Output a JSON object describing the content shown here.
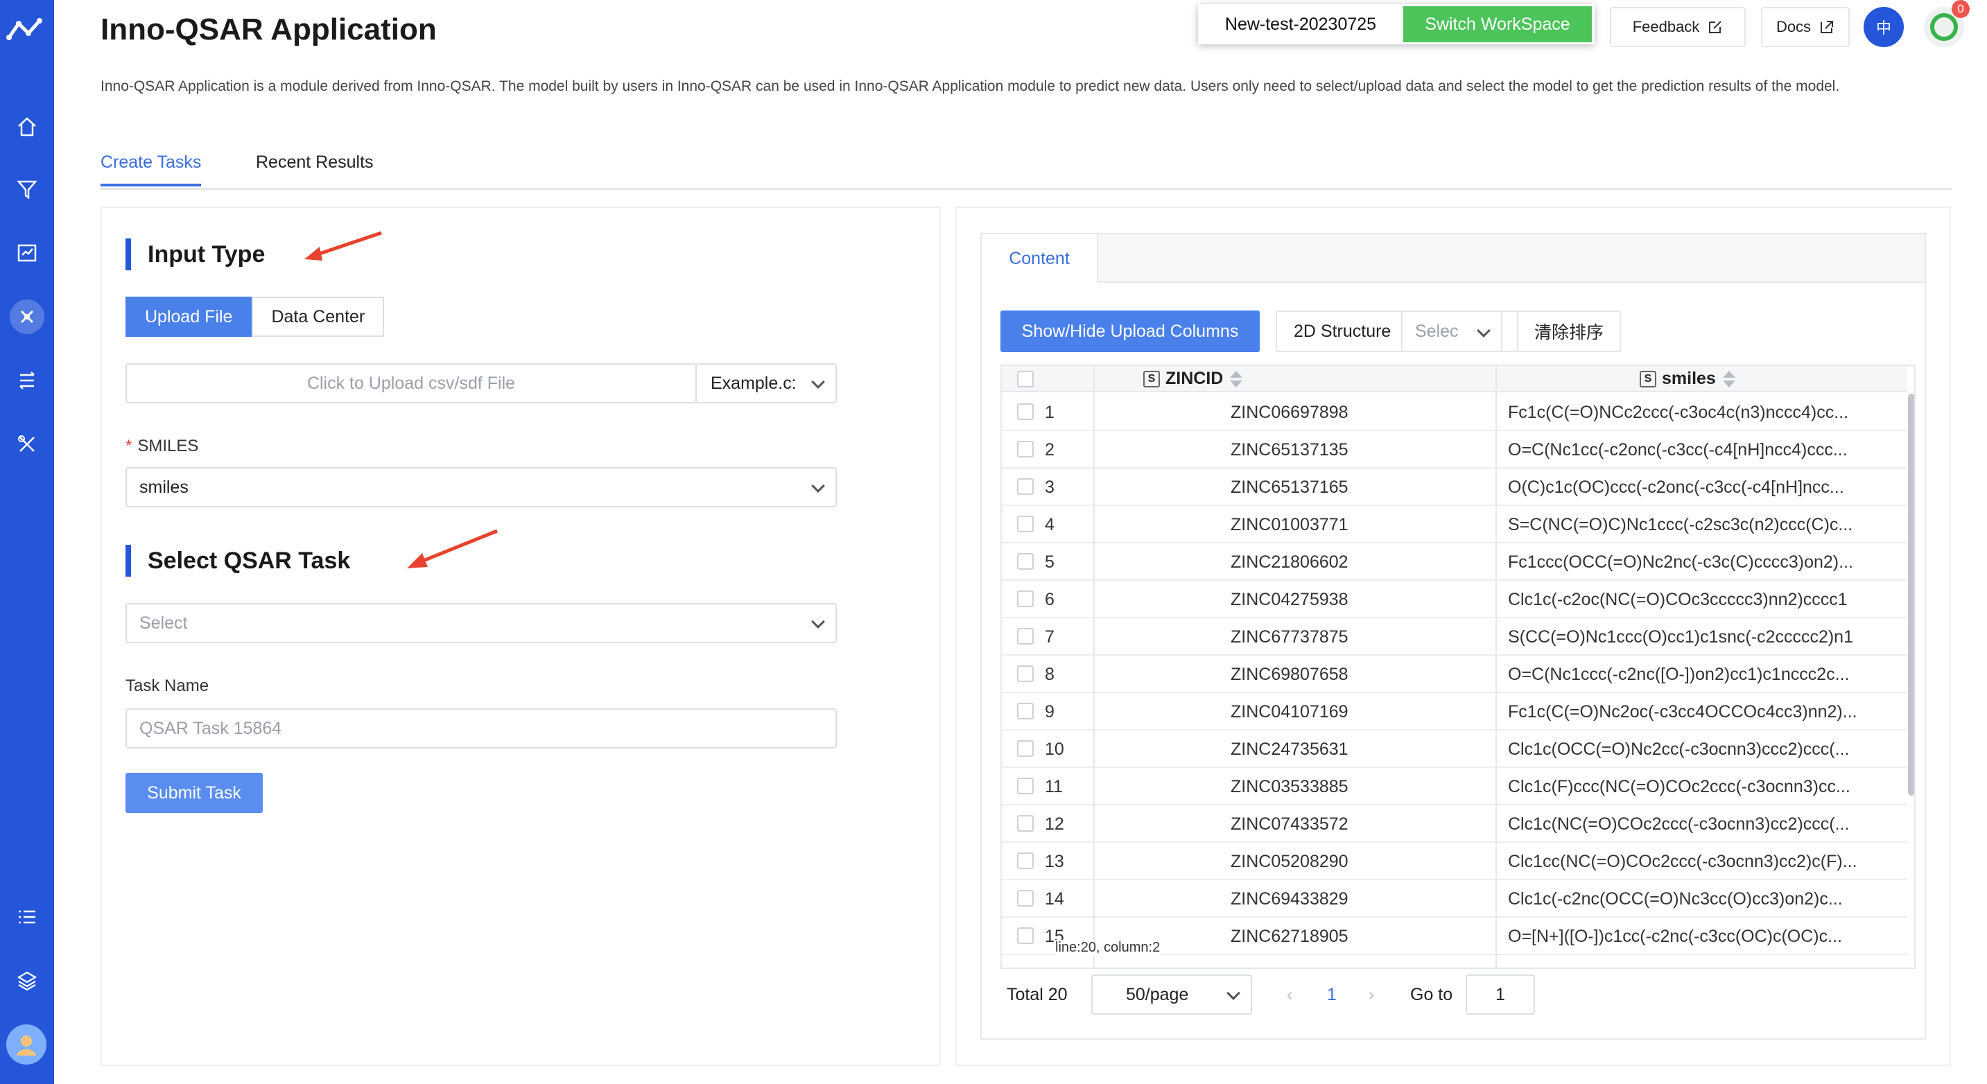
{
  "app": {
    "title": "Inno-QSAR Application",
    "description": "Inno-QSAR Application is a module derived from Inno-QSAR. The model built by users in Inno-QSAR can be used in Inno-QSAR Application module to predict new data. Users only need to select/upload data and select the model to get the prediction results of the model."
  },
  "header": {
    "workspace_name": "New-test-20230725",
    "switch_label": "Switch WorkSpace",
    "feedback_label": "Feedback",
    "docs_label": "Docs",
    "lang_label": "中",
    "notif_count": "0"
  },
  "tabs": [
    {
      "label": "Create Tasks",
      "active": true
    },
    {
      "label": "Recent Results",
      "active": false
    }
  ],
  "form": {
    "input_type_heading": "Input Type",
    "segments": [
      "Upload File",
      "Data Center"
    ],
    "upload_placeholder": "Click to Upload csv/sdf File",
    "example_label": "Example.c:",
    "smiles_label": "SMILES",
    "smiles_value": "smiles",
    "task_heading": "Select QSAR Task",
    "task_placeholder": "Select",
    "task_name_label": "Task Name",
    "task_name_placeholder": "QSAR Task 15864",
    "submit_label": "Submit Task"
  },
  "content": {
    "tab_label": "Content",
    "show_hide_label": "Show/Hide Upload Columns",
    "structure_label": "2D Structure",
    "structure_select": "Selec",
    "clear_sort_label": "清除排序",
    "col_id": "ZINCID",
    "col_smiles": "smiles",
    "col_icon": "S",
    "rows": [
      {
        "n": "1",
        "id": "ZINC06697898",
        "smiles": "Fc1c(C(=O)NCc2ccc(-c3oc4c(n3)nccc4)cc..."
      },
      {
        "n": "2",
        "id": "ZINC65137135",
        "smiles": "O=C(Nc1cc(-c2onc(-c3cc(-c4[nH]ncc4)ccc..."
      },
      {
        "n": "3",
        "id": "ZINC65137165",
        "smiles": "O(C)c1c(OC)ccc(-c2onc(-c3cc(-c4[nH]ncc..."
      },
      {
        "n": "4",
        "id": "ZINC01003771",
        "smiles": "S=C(NC(=O)C)Nc1ccc(-c2sc3c(n2)ccc(C)c..."
      },
      {
        "n": "5",
        "id": "ZINC21806602",
        "smiles": "Fc1ccc(OCC(=O)Nc2nc(-c3c(C)cccc3)on2)..."
      },
      {
        "n": "6",
        "id": "ZINC04275938",
        "smiles": "Clc1c(-c2oc(NC(=O)COc3ccccc3)nn2)cccc1"
      },
      {
        "n": "7",
        "id": "ZINC67737875",
        "smiles": "S(CC(=O)Nc1ccc(O)cc1)c1snc(-c2ccccc2)n1"
      },
      {
        "n": "8",
        "id": "ZINC69807658",
        "smiles": "O=C(Nc1ccc(-c2nc([O-])on2)cc1)c1nccc2c..."
      },
      {
        "n": "9",
        "id": "ZINC04107169",
        "smiles": "Fc1c(C(=O)Nc2oc(-c3cc4OCCOc4cc3)nn2)..."
      },
      {
        "n": "10",
        "id": "ZINC24735631",
        "smiles": "Clc1c(OCC(=O)Nc2cc(-c3ocnn3)ccc2)ccc(..."
      },
      {
        "n": "11",
        "id": "ZINC03533885",
        "smiles": "Clc1c(F)ccc(NC(=O)COc2ccc(-c3ocnn3)cc..."
      },
      {
        "n": "12",
        "id": "ZINC07433572",
        "smiles": "Clc1c(NC(=O)COc2ccc(-c3ocnn3)cc2)ccc(..."
      },
      {
        "n": "13",
        "id": "ZINC05208290",
        "smiles": "Clc1cc(NC(=O)COc2ccc(-c3ocnn3)cc2)c(F)..."
      },
      {
        "n": "14",
        "id": "ZINC69433829",
        "smiles": "Clc1c(-c2nc(OCC(=O)Nc3cc(O)cc3)on2)c..."
      },
      {
        "n": "15",
        "id": "ZINC62718905",
        "smiles": "O=[N+]([O-])c1cc(-c2nc(-c3cc(OC)c(OC)c..."
      }
    ],
    "cursor_info": "line:20, column:2",
    "total_label": "Total 20",
    "page_size": "50/page",
    "current_page": "1",
    "goto_label": "Go to",
    "goto_value": "1"
  },
  "colors": {
    "sidebar": "#2556d9",
    "accent": "#3a6fe0",
    "switch_green": "#4cc45a",
    "arrow_red": "#e8432f"
  }
}
